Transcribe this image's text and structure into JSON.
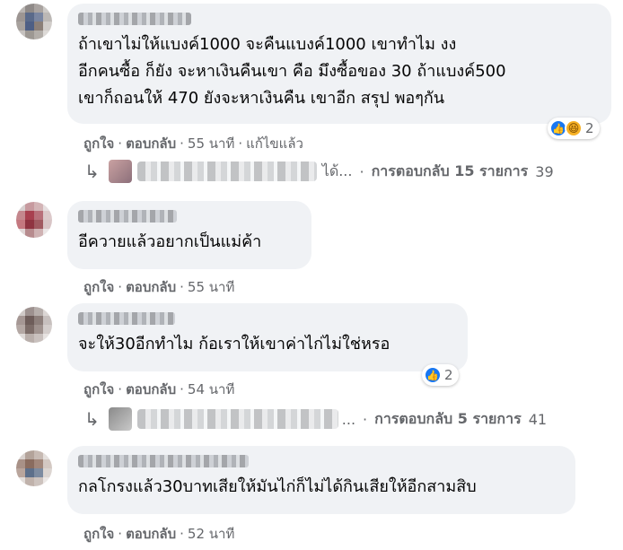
{
  "comments": [
    {
      "text": "ถ้าเขาไม่ให้แบงค์1000 จะคืนแบงค์1000 เขาทำไม งง\nอีกคนซื้อ ก็ยัง จะหาเงินคืนเขา คือ มึงซื้อของ 30 ถ้าแบงค์500\nเขาก็ถอนให้ 470 ยังจะหาเงินคืน เขาอีก สรุป พอๆกัน",
      "reaction_count": "2",
      "reactions": [
        "like-icon",
        "haha-icon"
      ],
      "like_label": "ถูกใจ",
      "reply_label": "ตอบกลับ",
      "time": "55 นาที",
      "edited_label": "แก้ไขแล้ว",
      "replies": {
        "snippet_tail": "ได้...",
        "summary": "การตอบกลับ 15 รายการ",
        "time": "39"
      }
    },
    {
      "text": "อีควายแล้วอยากเป็นแม่ค้า",
      "like_label": "ถูกใจ",
      "reply_label": "ตอบกลับ",
      "time": "55 นาที"
    },
    {
      "text": "จะให้30อีกทำไม ก้อเราให้เขาค่าไก่ไม่ใช่หรอ",
      "reaction_count": "2",
      "reactions": [
        "like-icon"
      ],
      "like_label": "ถูกใจ",
      "reply_label": "ตอบกลับ",
      "time": "54 นาที",
      "replies": {
        "snippet_tail": "...",
        "summary": "การตอบกลับ 5 รายการ",
        "time": "41"
      }
    },
    {
      "text": "กลโกรงแล้ว30บาทเสียให้มันไก่ก็ไม่ได้กินเสียให้อีกสามสิบ",
      "like_label": "ถูกใจ",
      "reply_label": "ตอบกลับ",
      "time": "52 นาที"
    }
  ],
  "colors": {
    "bubble": "#f0f2f5",
    "meta": "#65676b",
    "like": "#1877f2",
    "haha": "#f7b125"
  }
}
